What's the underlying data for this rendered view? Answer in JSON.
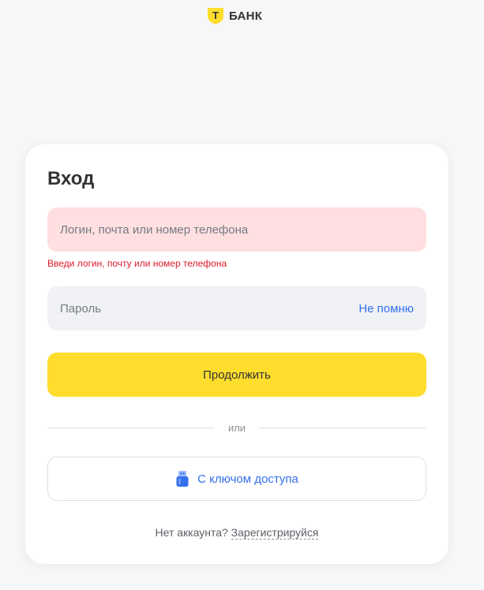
{
  "header": {
    "logo_text": "БАНК",
    "logo_letter": "Т"
  },
  "login_form": {
    "title": "Вход",
    "login_placeholder": "Логин, почта или номер телефона",
    "login_error": "Введи логин, почту или номер телефона",
    "password_placeholder": "Пароль",
    "forgot_label": "Не помню",
    "continue_label": "Продолжить",
    "divider_text": "или",
    "access_key_label": "С ключом доступа",
    "register_prompt": "Нет аккаунта?",
    "register_link": "Зарегистрируйся"
  },
  "colors": {
    "brand_yellow": "#ffdd2d",
    "link_blue": "#336fee",
    "error_red": "#dd1a2b",
    "error_field_bg": "#ffdfe0",
    "field_bg": "#f1f2f6",
    "page_bg": "#f6f7f8"
  },
  "icons": {
    "logo": "t-bank-shield-logo",
    "access_key": "usb-key-icon"
  }
}
